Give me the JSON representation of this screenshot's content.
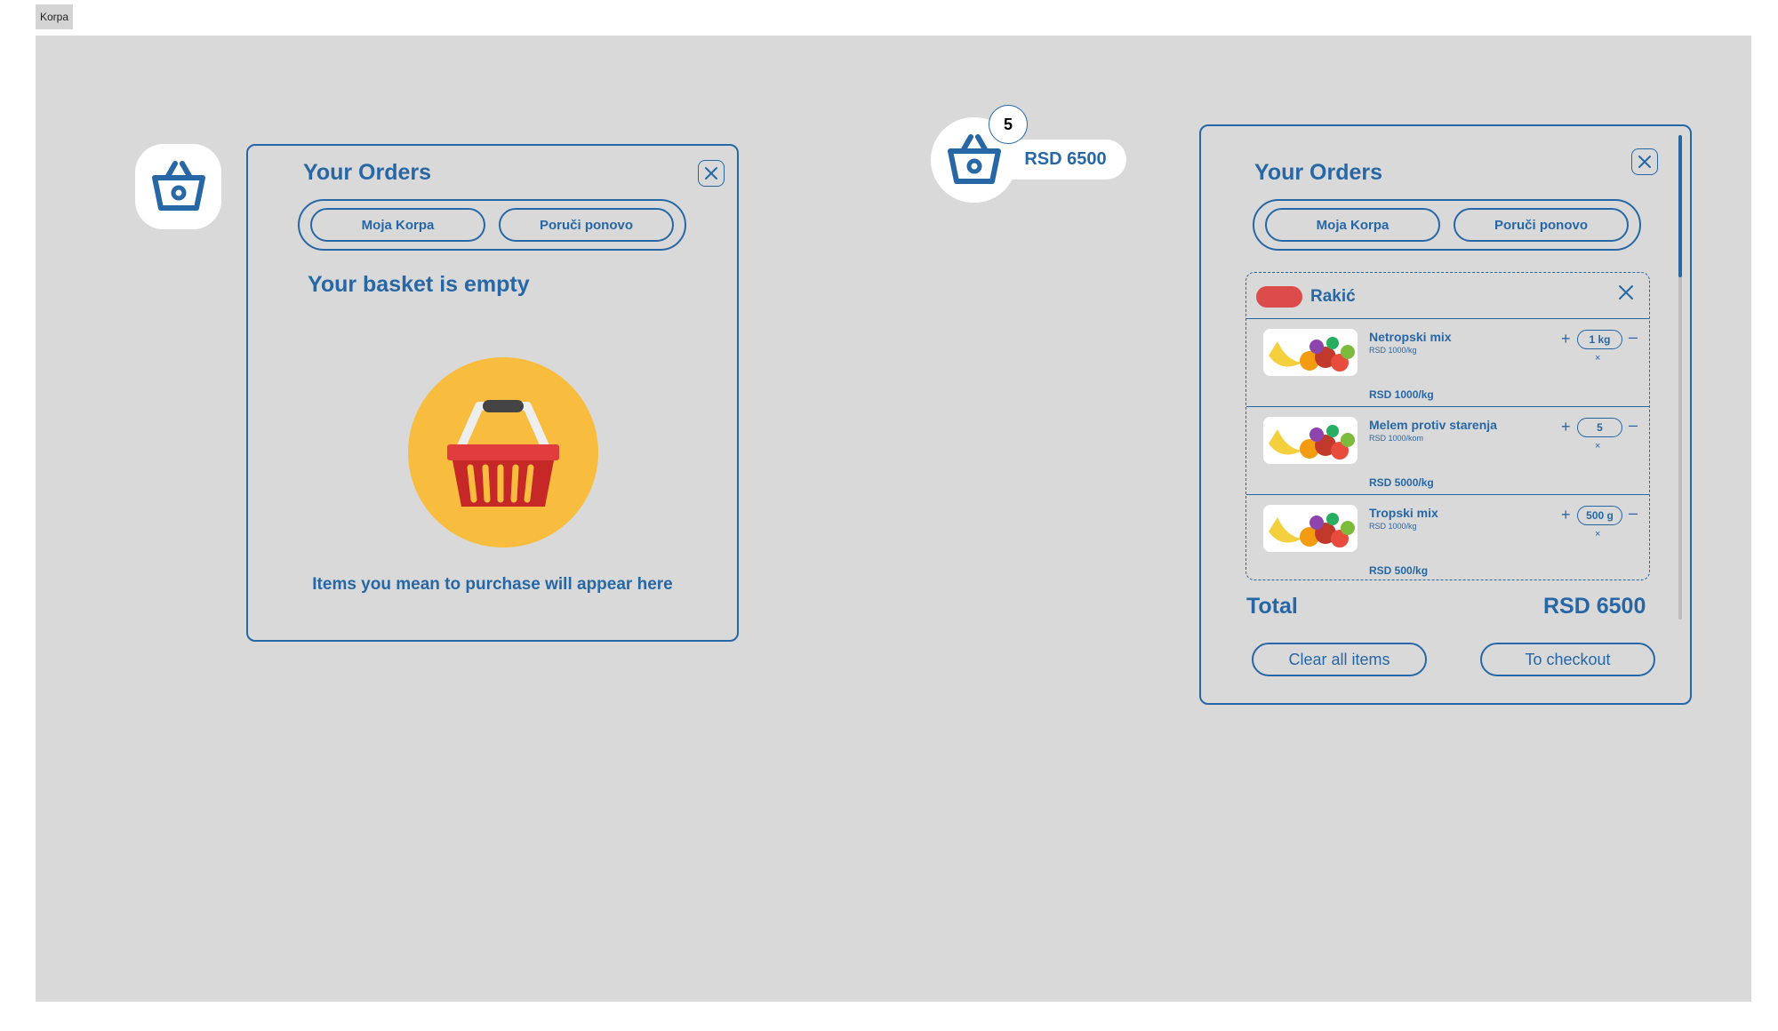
{
  "frame_label": "Korpa",
  "collapsed_basket": {
    "count": "5",
    "total": "RSD 6500"
  },
  "empty_panel": {
    "title": "Your Orders",
    "tabs": [
      "Moja Korpa",
      "Poruči ponovo"
    ],
    "empty_title": "Your basket is empty",
    "empty_caption": "Items you mean to purchase will appear here"
  },
  "orders_panel": {
    "title": "Your Orders",
    "tabs": [
      "Moja Korpa",
      "Poruči ponovo"
    ],
    "shop": {
      "name": "Rakić",
      "color": "#db4c4a",
      "items": [
        {
          "name": "Netropski mix",
          "unit_price": "RSD 1000/kg",
          "quantity": "1 kg",
          "line_total": "RSD 1000/kg"
        },
        {
          "name": "Melem protiv starenja",
          "unit_price": "RSD 1000/kom",
          "quantity": "5",
          "line_total": "RSD 5000/kg"
        },
        {
          "name": "Tropski mix",
          "unit_price": "RSD 1000/kg",
          "quantity": "500 g",
          "line_total": "RSD 500/kg"
        }
      ]
    },
    "total_label": "Total",
    "total_value": "RSD 6500",
    "clear_label": "Clear all items",
    "checkout_label": "To checkout"
  },
  "icons": {
    "basket": "basket-icon",
    "close": "close-icon",
    "plus": "plus-icon",
    "minus": "minus-icon",
    "remove": "remove-icon",
    "empty_basket": "empty-basket-illustration",
    "fruit": "fruit-image"
  },
  "colors": {
    "accent": "#2767a6",
    "background": "#d9d9d9",
    "illustration_bg": "#f8bd3e",
    "shop_badge": "#db4c4a"
  }
}
